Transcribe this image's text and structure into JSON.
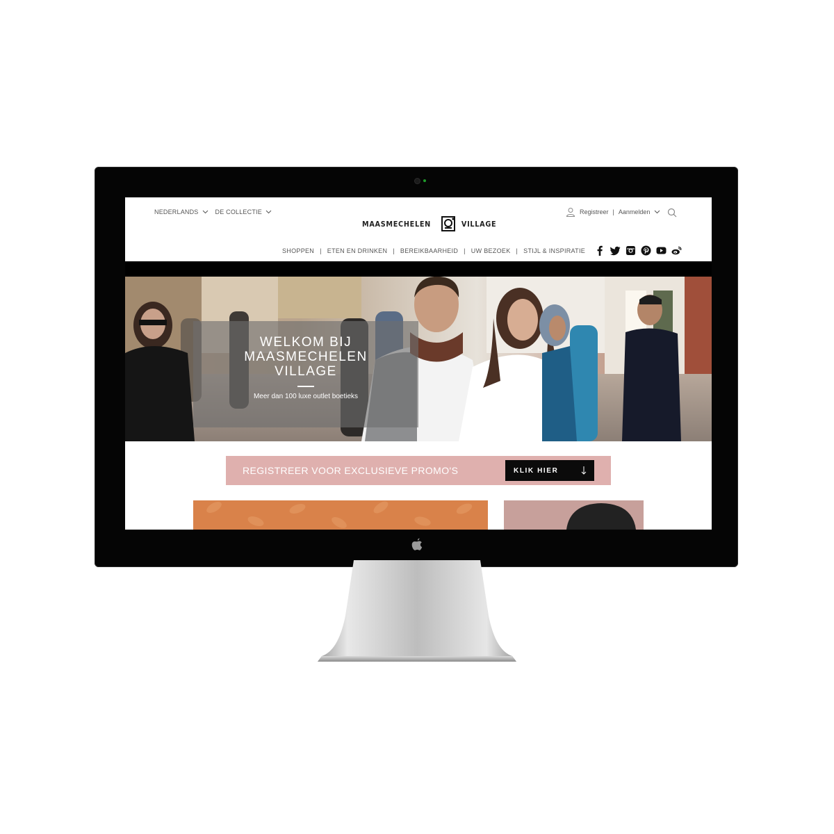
{
  "header": {
    "language": "NEDERLANDS",
    "collection": "DE COLLECTIE",
    "logo_left": "MAASMECHELEN",
    "logo_right": "VILLAGE",
    "register": "Registreer",
    "divider": "|",
    "login": "Aanmelden"
  },
  "nav": {
    "items": [
      "SHOPPEN",
      "ETEN EN DRINKEN",
      "BEREIKBAARHEID",
      "UW BEZOEK",
      "STIJL & INSPIRATIE"
    ],
    "separator": "|"
  },
  "social": [
    "facebook-icon",
    "twitter-icon",
    "instagram-icon",
    "pinterest-icon",
    "youtube-icon",
    "weibo-icon"
  ],
  "hero": {
    "title": "WELKOM BIJ MAASMECHELEN VILLAGE",
    "subtitle": "Meer dan 100 luxe outlet boetieks"
  },
  "promo": {
    "text": "REGISTREER VOOR EXCLUSIEVE PROMO'S",
    "button": "KLIK HIER"
  },
  "colors": {
    "promo_bg": "#dfb0ae",
    "button_bg": "#0b0b0b",
    "tile_orange": "#d9824a"
  }
}
